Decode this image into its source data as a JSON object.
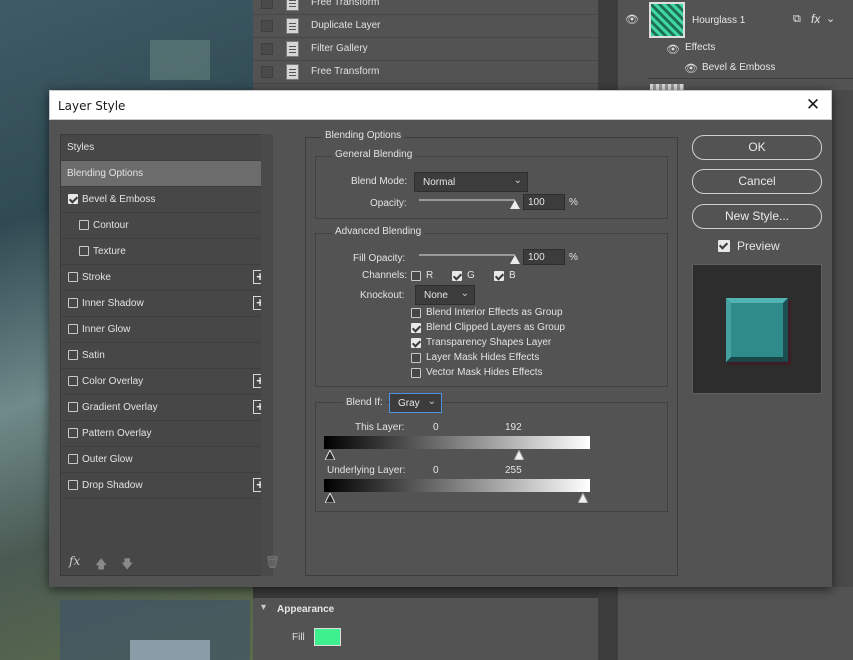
{
  "history": {
    "items": [
      "Free Transform",
      "Duplicate Layer",
      "Filter Gallery",
      "Free Transform"
    ]
  },
  "layers": {
    "layer_name": "Hourglass 1",
    "fx_label": "fx",
    "effects_label": "Effects",
    "effect_item": "Bevel & Emboss"
  },
  "appearance": {
    "title": "Appearance",
    "fill_label": "Fill",
    "fill_color": "#3ff08f"
  },
  "dialog": {
    "title": "Layer Style",
    "styles_header": "Styles",
    "style_items": [
      {
        "label": "Blending Options",
        "checkbox": false,
        "checked": false,
        "plus": false,
        "selected": true
      },
      {
        "label": "Bevel & Emboss",
        "checkbox": true,
        "checked": true,
        "plus": false,
        "selected": false
      },
      {
        "label": "Contour",
        "checkbox": true,
        "checked": false,
        "plus": false,
        "selected": false,
        "indent": true
      },
      {
        "label": "Texture",
        "checkbox": true,
        "checked": false,
        "plus": false,
        "selected": false,
        "indent": true
      },
      {
        "label": "Stroke",
        "checkbox": true,
        "checked": false,
        "plus": true,
        "selected": false
      },
      {
        "label": "Inner Shadow",
        "checkbox": true,
        "checked": false,
        "plus": true,
        "selected": false
      },
      {
        "label": "Inner Glow",
        "checkbox": true,
        "checked": false,
        "plus": false,
        "selected": false
      },
      {
        "label": "Satin",
        "checkbox": true,
        "checked": false,
        "plus": false,
        "selected": false
      },
      {
        "label": "Color Overlay",
        "checkbox": true,
        "checked": false,
        "plus": true,
        "selected": false
      },
      {
        "label": "Gradient Overlay",
        "checkbox": true,
        "checked": false,
        "plus": true,
        "selected": false
      },
      {
        "label": "Pattern Overlay",
        "checkbox": true,
        "checked": false,
        "plus": false,
        "selected": false
      },
      {
        "label": "Outer Glow",
        "checkbox": true,
        "checked": false,
        "plus": false,
        "selected": false
      },
      {
        "label": "Drop Shadow",
        "checkbox": true,
        "checked": false,
        "plus": true,
        "selected": false
      }
    ],
    "footer_fx": "fx",
    "blending_options": {
      "panel_title": "Blending Options",
      "general": {
        "title": "General Blending",
        "blend_mode_label": "Blend Mode:",
        "blend_mode_value": "Normal",
        "opacity_label": "Opacity:",
        "opacity_value": "100",
        "opacity_unit": "%",
        "opacity_fraction": 1.0
      },
      "advanced": {
        "title": "Advanced Blending",
        "fill_opacity_label": "Fill Opacity:",
        "fill_opacity_value": "100",
        "fill_opacity_unit": "%",
        "fill_opacity_fraction": 1.0,
        "channels_label": "Channels:",
        "channels": [
          {
            "label": "R",
            "checked": false
          },
          {
            "label": "G",
            "checked": true
          },
          {
            "label": "B",
            "checked": true
          }
        ],
        "knockout_label": "Knockout:",
        "knockout_value": "None",
        "options": [
          {
            "label": "Blend Interior Effects as Group",
            "checked": false
          },
          {
            "label": "Blend Clipped Layers as Group",
            "checked": true
          },
          {
            "label": "Transparency Shapes Layer",
            "checked": true
          },
          {
            "label": "Layer Mask Hides Effects",
            "checked": false
          },
          {
            "label": "Vector Mask Hides Effects",
            "checked": false
          }
        ]
      },
      "blend_if": {
        "label": "Blend If:",
        "value": "Gray",
        "this_layer_label": "This Layer:",
        "this_layer_low": "0",
        "this_layer_high": "192",
        "underlying_label": "Underlying Layer:",
        "underlying_low": "0",
        "underlying_high": "255"
      }
    },
    "buttons": {
      "ok": "OK",
      "cancel": "Cancel",
      "new_style": "New Style...",
      "preview_label": "Preview",
      "preview_checked": true
    }
  }
}
